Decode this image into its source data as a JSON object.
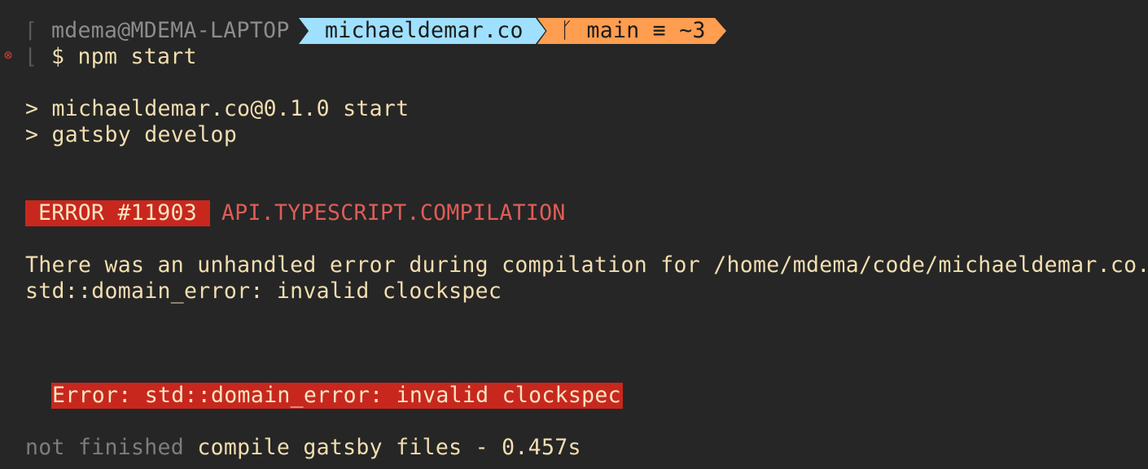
{
  "prompt": {
    "user_host": "mdema@MDEMA-LAPTOP",
    "directory": "michaeldemar.co",
    "git_branch_icon": "git-branch-icon",
    "git_info": "main ≡ ~3",
    "status_icon": "error-circle-icon",
    "dollar": "$",
    "command": "npm start"
  },
  "output": {
    "script_line_1": "> michaeldemar.co@0.1.0 start",
    "script_line_2": "> gatsby develop",
    "error_badge": "ERROR #11903",
    "error_type": "API.TYPESCRIPT.COMPILATION",
    "message_line_1": "There was an unhandled error during compilation for /home/mdema/code/michaeldemar.co. P",
    "message_line_2": "std::domain_error: invalid clockspec",
    "error_detail": "Error: std::domain_error: invalid clockspec",
    "status_prefix": "not finished",
    "status_text": "compile gatsby files - 0.457s"
  },
  "colors": {
    "background": "#262626",
    "text": "#f2deb0",
    "error_red": "#c8271e",
    "error_type_red": "#e05c56",
    "segment_blue": "#9fe0ff",
    "segment_orange": "#ff9d50",
    "dim_gray": "#7d7d7d"
  }
}
